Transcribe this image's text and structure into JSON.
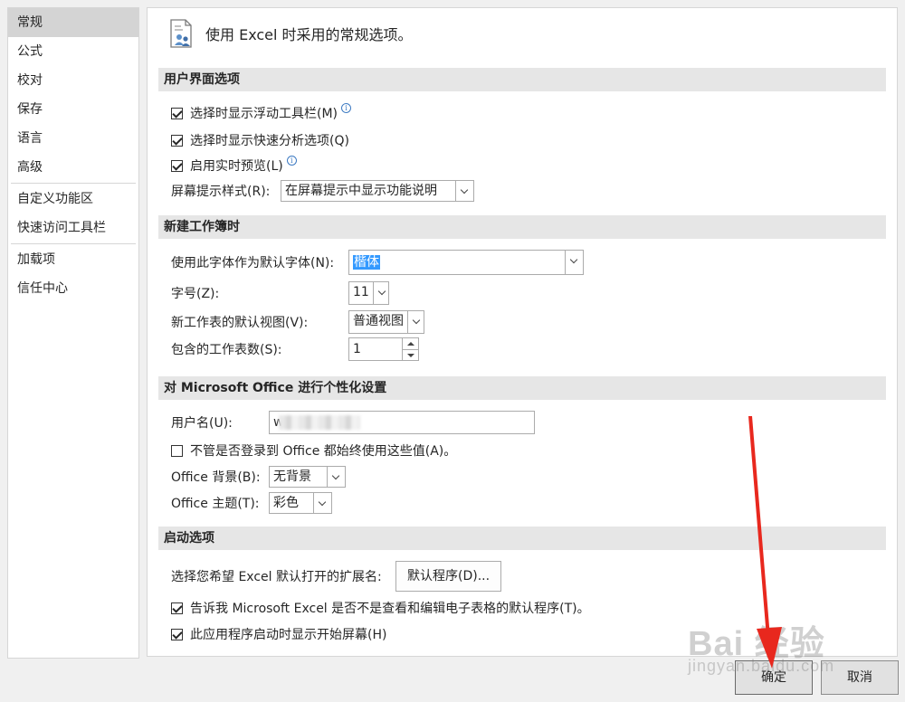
{
  "sidebar": {
    "items": [
      {
        "label": "常规",
        "active": true
      },
      {
        "label": "公式"
      },
      {
        "label": "校对"
      },
      {
        "label": "保存"
      },
      {
        "label": "语言"
      },
      {
        "label": "高级"
      },
      {
        "label": "自定义功能区"
      },
      {
        "label": "快速访问工具栏"
      },
      {
        "label": "加载项"
      },
      {
        "label": "信任中心"
      }
    ]
  },
  "header": {
    "title": "使用 Excel 时采用的常规选项。"
  },
  "sections": {
    "ui": {
      "title": "用户界面选项",
      "mini_toolbar": "选择时显示浮动工具栏(M)",
      "quick_analysis": "选择时显示快速分析选项(Q)",
      "live_preview": "启用实时预览(L)",
      "screentip_label": "屏幕提示样式(R):",
      "screentip_value": "在屏幕提示中显示功能说明",
      "info_glyph": "i"
    },
    "new_workbook": {
      "title": "新建工作簿时",
      "font_label": "使用此字体作为默认字体(N):",
      "font_value": "楷体",
      "size_label": "字号(Z):",
      "size_value": "11",
      "view_label": "新工作表的默认视图(V):",
      "view_value": "普通视图",
      "sheets_label": "包含的工作表数(S):",
      "sheets_value": "1"
    },
    "personalize": {
      "title": "对 Microsoft Office 进行个性化设置",
      "username_label": "用户名(U):",
      "username_value": "w",
      "always_use": "不管是否登录到 Office 都始终使用这些值(A)。",
      "background_label": "Office 背景(B):",
      "background_value": "无背景",
      "theme_label": "Office 主题(T):",
      "theme_value": "彩色"
    },
    "startup": {
      "title": "启动选项",
      "ext_label": "选择您希望 Excel 默认打开的扩展名:",
      "default_programs_button": "默认程序(D)...",
      "tell_me": "告诉我 Microsoft Excel 是否不是查看和编辑电子表格的默认程序(T)。",
      "show_start": "此应用程序启动时显示开始屏幕(H)"
    }
  },
  "footer": {
    "ok": "确定",
    "cancel": "取消"
  },
  "watermark": {
    "main": "Bai 经验",
    "sub": "jingyan.baidu.com"
  },
  "colors": {
    "arrow": "#e8281e",
    "highlight": "#3399ff"
  }
}
